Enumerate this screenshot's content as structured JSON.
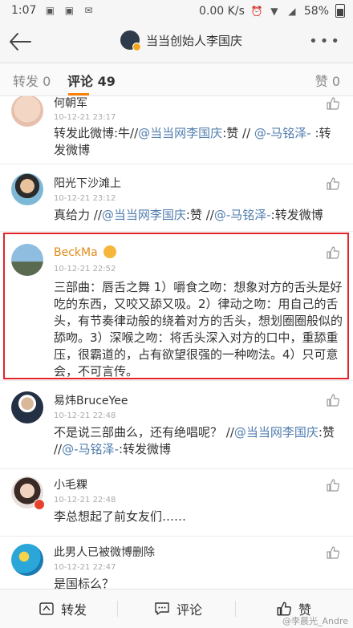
{
  "status_bar": {
    "time": "1:07",
    "network_speed": "0.00 K/s",
    "battery": "58%"
  },
  "header": {
    "title": "当当创始人李国庆"
  },
  "tabs": [
    {
      "label": "转发",
      "count": "0"
    },
    {
      "label": "评论",
      "count": "49"
    },
    {
      "label": "赞",
      "count": "0"
    }
  ],
  "comments": [
    {
      "name": "何朝军",
      "time": "10-12-21 23:17",
      "text_a": "转发此微博:牛//",
      "link1": "@当当网李国庆",
      "text_b": ":赞 // ",
      "link2": "@-马铭泽-",
      "text_c": " :转发微博"
    },
    {
      "name": "阳光下沙滩上",
      "time": "10-12-21 23:12",
      "text_a": "真给力 //",
      "link1": "@当当网李国庆",
      "text_b": ":赞 //",
      "link2": "@-马铭泽-",
      "text_c": ":转发微博"
    },
    {
      "name": "BeckMa",
      "time": "10-12-21 22:52",
      "text": "三部曲：唇舌之舞 1）嚼食之吻：想象对方的舌头是好吃的东西，又咬又舔又吸。2）律动之吻：用自己的舌头，有节奏律动般的绕着对方的舌头，想划圈圈般似的舔吻。3）深喉之吻：将舌头深入对方的口中，重舔重压，很霸道的，占有欲望很强的一种吻法。4）只可意会，不可言传。"
    },
    {
      "name": "易炜BruceYee",
      "time": "10-12-21 22:48",
      "text_a": "不是说三部曲么，还有绝唱呢？ //",
      "link1": "@当当网李国庆",
      "text_b": ":赞 //",
      "link2": "@-马铭泽-",
      "text_c": ":转发微博"
    },
    {
      "name": "小毛粿",
      "time": "10-12-21 22:48",
      "text": "李总想起了前女友们……"
    },
    {
      "name": "此男人已被微博删除",
      "time": "10-12-21 22:47",
      "text": "是国标么？"
    }
  ],
  "bottom_bar": {
    "repost": "转发",
    "comment": "评论",
    "like": "赞",
    "watermark": "@李晨光_Andre"
  },
  "colors": {
    "accent": "#ff8200",
    "link": "#507daf",
    "highlight_border": "#e3242b"
  }
}
